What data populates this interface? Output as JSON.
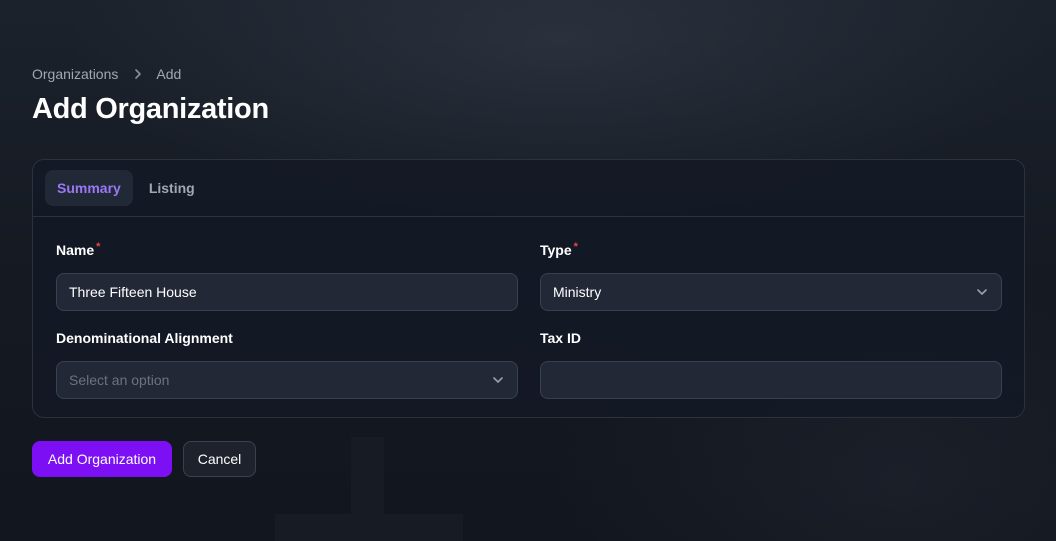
{
  "breadcrumb": {
    "items": [
      {
        "label": "Organizations"
      },
      {
        "label": "Add"
      }
    ]
  },
  "page_title": "Add Organization",
  "tabs": [
    {
      "label": "Summary",
      "active": true
    },
    {
      "label": "Listing",
      "active": false
    }
  ],
  "form": {
    "name": {
      "label": "Name",
      "required": true,
      "value": "Three Fifteen House"
    },
    "type": {
      "label": "Type",
      "required": true,
      "value": "Ministry"
    },
    "denomination": {
      "label": "Denominational Alignment",
      "required": false,
      "placeholder": "Select an option"
    },
    "tax_id": {
      "label": "Tax ID",
      "required": false,
      "value": ""
    }
  },
  "required_marker": "*",
  "actions": {
    "submit_label": "Add Organization",
    "cancel_label": "Cancel"
  },
  "colors": {
    "accent": "#7c0ff3",
    "active_tab_text": "#9b78f5",
    "required": "#ef4444"
  },
  "icons": {
    "breadcrumb_separator": "chevron-right-icon",
    "select_indicator": "chevron-down-icon"
  }
}
